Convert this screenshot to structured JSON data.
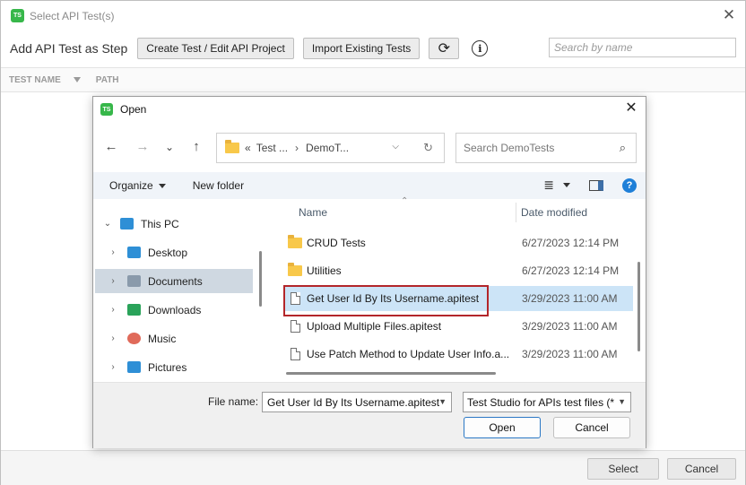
{
  "window": {
    "title": "Select API Test(s)",
    "logo": "TS",
    "close_glyph": "✕"
  },
  "toolbar": {
    "heading": "Add API Test as Step",
    "create_label": "Create Test / Edit API Project",
    "import_label": "Import Existing Tests",
    "refresh_glyph": "⟳",
    "info_glyph": "i",
    "search_placeholder": "Search by name"
  },
  "grid": {
    "col_test_name": "TEST NAME",
    "col_path": "PATH"
  },
  "footer": {
    "select_label": "Select",
    "cancel_label": "Cancel"
  },
  "open_dialog": {
    "title": "Open",
    "logo": "TS",
    "close_glyph": "✕",
    "nav": {
      "back": "←",
      "forward": "→",
      "recent": "⌄",
      "up": "↑"
    },
    "address": {
      "prefix": "«",
      "crumb1": "Test ...",
      "separator": "›",
      "crumb2": "DemoT...",
      "dropdown": "⌵",
      "refresh": "↻"
    },
    "search_placeholder": "Search DemoTests",
    "commands": {
      "organize": "Organize",
      "new_folder": "New folder"
    },
    "nav_pane": [
      {
        "label": "This PC",
        "chev": "⌄",
        "icon": "monitor-icon",
        "color": "#2e8fd6"
      },
      {
        "label": "Desktop",
        "chev": "›",
        "icon": "desktop-icon",
        "color": "#2e8fd6"
      },
      {
        "label": "Documents",
        "chev": "›",
        "icon": "documents-icon",
        "color": "#8a9aab",
        "selected": true
      },
      {
        "label": "Downloads",
        "chev": "›",
        "icon": "download-icon",
        "color": "#2aa35a"
      },
      {
        "label": "Music",
        "chev": "›",
        "icon": "music-icon",
        "color": "#e06a5a"
      },
      {
        "label": "Pictures",
        "chev": "›",
        "icon": "pictures-icon",
        "color": "#2e8fd6"
      }
    ],
    "columns": {
      "name": "Name",
      "date_modified": "Date modified",
      "sort_glyph": "⌃"
    },
    "files": [
      {
        "name": "CRUD Tests",
        "date": "6/27/2023 12:14 PM",
        "type": "folder"
      },
      {
        "name": "Utilities",
        "date": "6/27/2023 12:14 PM",
        "type": "folder"
      },
      {
        "name": "Get User Id By Its Username.apitest",
        "date": "3/29/2023 11:00 AM",
        "type": "file",
        "selected": true
      },
      {
        "name": "Upload Multiple Files.apitest",
        "date": "3/29/2023 11:00 AM",
        "type": "file"
      },
      {
        "name": "Use Patch Method to Update User Info.a...",
        "date": "3/29/2023 11:00 AM",
        "type": "file"
      }
    ],
    "file_name_label": "File name:",
    "file_name_value": "Get User Id By Its Username.apitest",
    "file_type_value": "Test Studio for APIs test files  (*",
    "open_label": "Open",
    "cancel_label": "Cancel",
    "help_glyph": "?"
  },
  "colors": {
    "accent": "#2b78c5",
    "highlight_border": "#b3262a",
    "selected_row": "#cce4f7",
    "logo_green": "#37b74a"
  }
}
